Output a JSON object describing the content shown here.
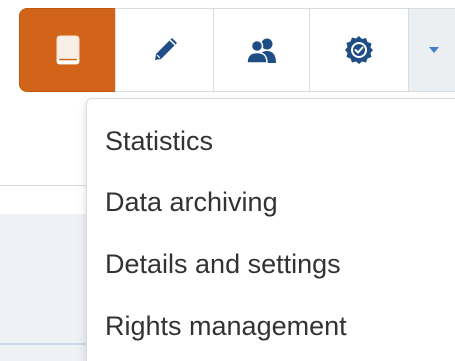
{
  "toolbar": {
    "buttons": [
      {
        "icon": "book-icon",
        "active": true,
        "color": "#d2641a"
      },
      {
        "icon": "pencil-icon",
        "active": false
      },
      {
        "icon": "users-icon",
        "active": false
      },
      {
        "icon": "badge-check-icon",
        "active": false
      },
      {
        "icon": "caret-down-icon",
        "active": false
      }
    ],
    "accent_color": "#d2641a",
    "icon_color": "#1f4e86"
  },
  "menu": {
    "items": [
      {
        "label": "Statistics"
      },
      {
        "label": "Data archiving"
      },
      {
        "label": "Details and settings"
      },
      {
        "label": "Rights management"
      }
    ]
  }
}
